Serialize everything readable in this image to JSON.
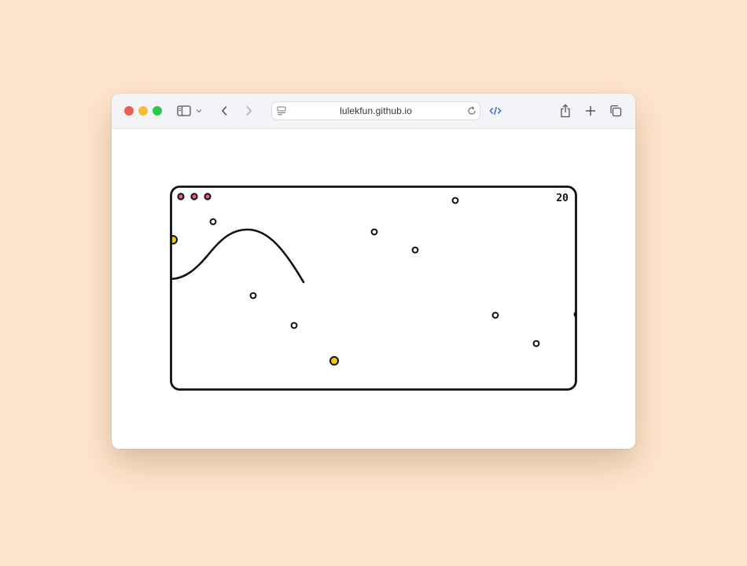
{
  "browser": {
    "url": "lulekfun.github.io",
    "icons": {
      "sidebar": "sidebar-toggle-icon",
      "sidebar_menu": "chevron-down-icon",
      "back": "chevron-left-icon",
      "forward": "chevron-right-icon",
      "page_menu": "page-menu-icon",
      "reload": "reload-icon",
      "devtools": "code-icon",
      "share": "share-icon",
      "new_tab": "plus-icon",
      "tabs": "tab-overview-icon"
    }
  },
  "game": {
    "score": "20",
    "lives": 3,
    "colors": {
      "border": "#111111",
      "life": "#e0607e",
      "coin": "#f2cc0c",
      "dot": "#ffffff"
    }
  }
}
